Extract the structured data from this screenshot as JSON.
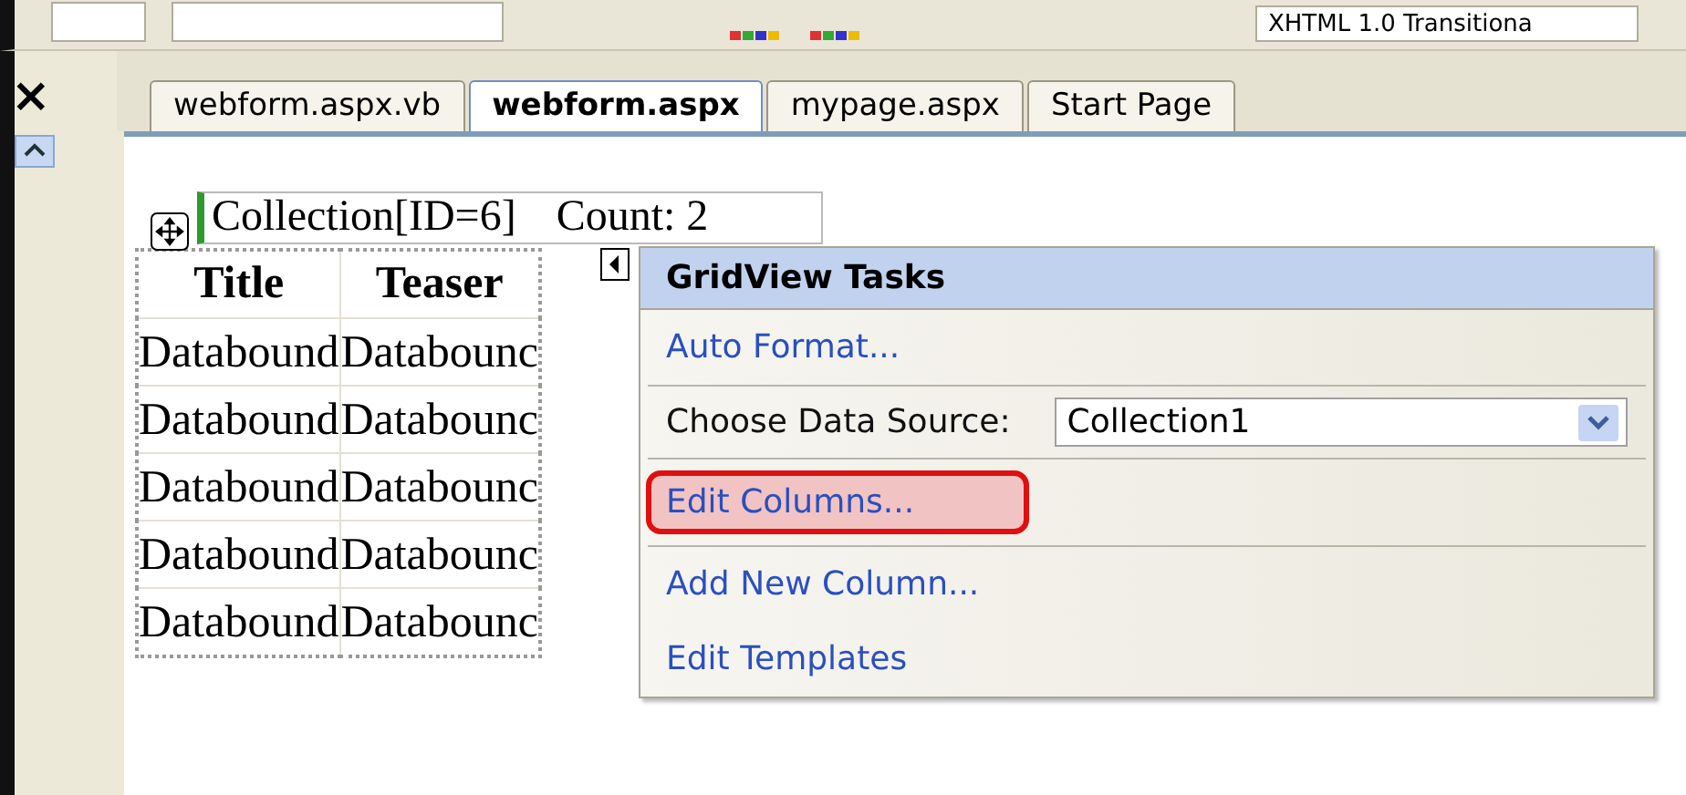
{
  "toolbar": {
    "doctype": "XHTML 1.0 Transitiona"
  },
  "side_panel": {
    "close": "×"
  },
  "tabs": [
    {
      "label": "webform.aspx.vb",
      "selected": false
    },
    {
      "label": "webform.aspx",
      "selected": true
    },
    {
      "label": "mypage.aspx",
      "selected": false
    },
    {
      "label": "Start Page",
      "selected": false
    }
  ],
  "grid_caption": {
    "source": "Collection[ID=6]",
    "count": "Count: 2"
  },
  "table": {
    "columns": [
      "Title",
      "Teaser"
    ],
    "rows": [
      [
        "Databound",
        "Databounc"
      ],
      [
        "Databound",
        "Databounc"
      ],
      [
        "Databound",
        "Databounc"
      ],
      [
        "Databound",
        "Databounc"
      ],
      [
        "Databound",
        "Databounc"
      ]
    ]
  },
  "tasks_panel": {
    "title": "GridView Tasks",
    "items": [
      {
        "kind": "link",
        "label": "Auto Format...",
        "highlighted": false
      },
      {
        "kind": "select",
        "label": "Choose Data Source:",
        "value": "Collection1"
      },
      {
        "kind": "link",
        "label": "Edit Columns...",
        "highlighted": true
      },
      {
        "kind": "link",
        "label": "Add New Column...",
        "highlighted": false
      },
      {
        "kind": "link",
        "label": "Edit Templates",
        "highlighted": false
      }
    ]
  }
}
